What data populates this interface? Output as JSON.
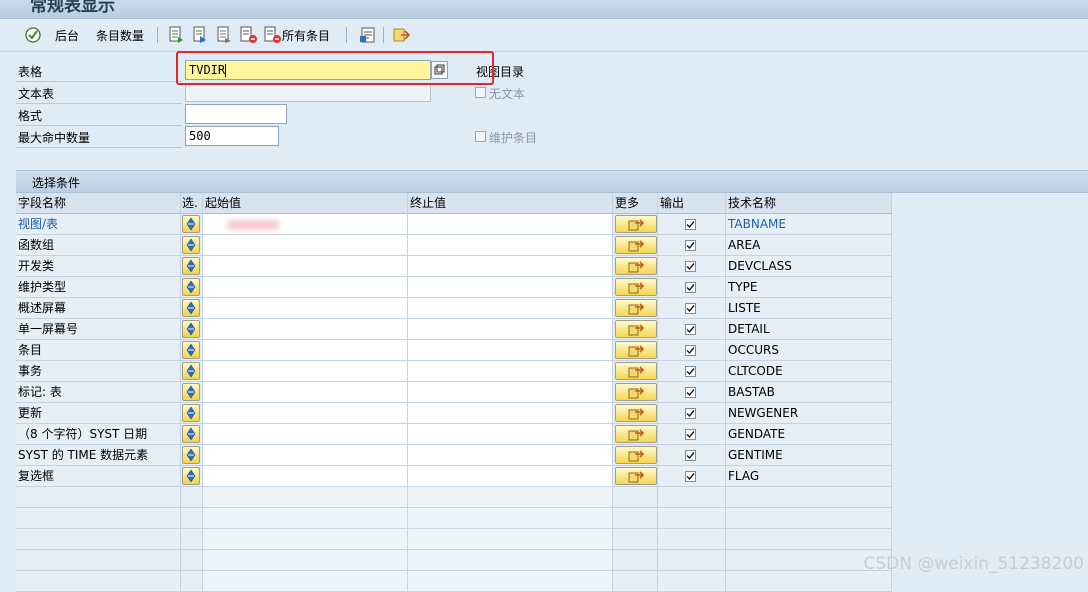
{
  "window": {
    "title": "常规表显示"
  },
  "toolbar": {
    "execute_icon": "execute-icon",
    "background_label": "后台",
    "entry_count_label": "条目数量",
    "all_entries_label": "所有条目"
  },
  "form": {
    "table_label": "表格",
    "table_value": "TVDIR",
    "view_catalog_label": "视图目录",
    "text_table_label": "文本表",
    "no_text_label": "无文本",
    "format_label": "格式",
    "format_value": "",
    "max_hits_label": "最大命中数量",
    "max_hits_value": "500",
    "maintain_entries_label": "维护条目"
  },
  "selection": {
    "section_title": "选择条件",
    "headers": {
      "field_name": "字段名称",
      "select": "选.",
      "low": "起始值",
      "high": "终止值",
      "more": "更多",
      "output": "输出",
      "tech_name": "技术名称"
    },
    "rows": [
      {
        "name": "视图/表",
        "tech": "TABNAME",
        "output": true,
        "highlight": true
      },
      {
        "name": "函数组",
        "tech": "AREA",
        "output": true
      },
      {
        "name": "开发类",
        "tech": "DEVCLASS",
        "output": true
      },
      {
        "name": "维护类型",
        "tech": "TYPE",
        "output": true
      },
      {
        "name": "概述屏幕",
        "tech": "LISTE",
        "output": true
      },
      {
        "name": "单一屏幕号",
        "tech": "DETAIL",
        "output": true
      },
      {
        "name": "条目",
        "tech": "OCCURS",
        "output": true
      },
      {
        "name": "事务",
        "tech": "CLTCODE",
        "output": true
      },
      {
        "name": "标记: 表",
        "tech": "BASTAB",
        "output": true
      },
      {
        "name": "更新",
        "tech": "NEWGENER",
        "output": true
      },
      {
        "name": "（8 个字符）SYST 日期",
        "tech": "GENDATE",
        "output": true
      },
      {
        "name": "SYST 的 TIME 数据元素",
        "tech": "GENTIME",
        "output": true
      },
      {
        "name": "复选框",
        "tech": "FLAG",
        "output": true
      }
    ],
    "empty_rows": 5
  },
  "watermark": "CSDN @weixin_51238200",
  "colors": {
    "highlight_input": "#fff59d",
    "link": "#1d5ea8",
    "red_box": "#e8242b"
  }
}
